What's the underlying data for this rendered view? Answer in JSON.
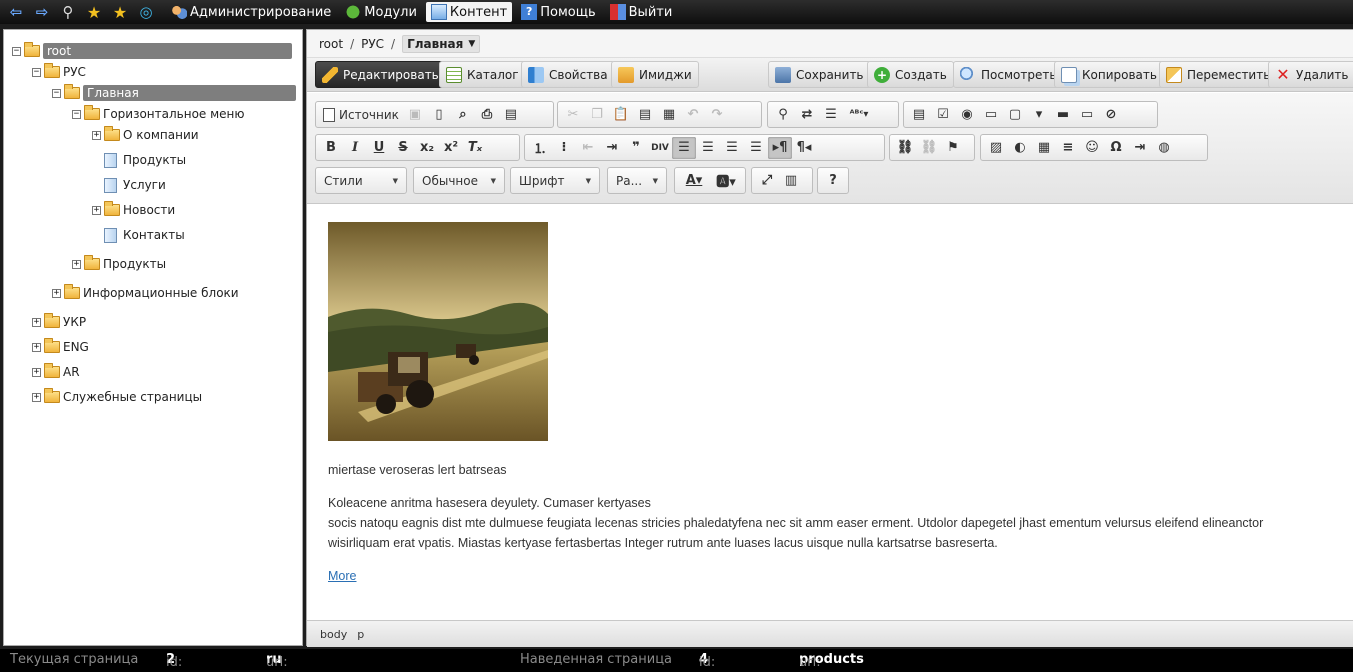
{
  "topbar": {
    "menu": [
      {
        "label": "Администрирование",
        "icon": "users-icon"
      },
      {
        "label": "Модули",
        "icon": "puzzle-icon"
      },
      {
        "label": "Контент",
        "icon": "content-icon",
        "active": true
      },
      {
        "label": "Помощь",
        "icon": "help-icon"
      },
      {
        "label": "Выйти",
        "icon": "exit-icon"
      }
    ]
  },
  "tree": {
    "root": "root",
    "rus": "РУС",
    "main": "Главная",
    "hmenu": "Горизонтальное меню",
    "about": "О компании",
    "products_page": "Продукты",
    "services": "Услуги",
    "news": "Новости",
    "contacts": "Контакты",
    "products": "Продукты",
    "infoblocks": "Информационные блоки",
    "ukr": "УКР",
    "eng": "ENG",
    "ar": "AR",
    "service_pages": "Служебные страницы"
  },
  "breadcrumb": {
    "root": "root",
    "rus": "РУС",
    "current": "Главная"
  },
  "actions": {
    "edit": "Редактировать",
    "catalog": "Каталог",
    "properties": "Свойства",
    "images": "Имиджи",
    "save": "Сохранить",
    "create": "Создать",
    "view": "Посмотреть",
    "copy": "Копировать",
    "move": "Переместить",
    "delete": "Удалить"
  },
  "editor": {
    "source": "Источник",
    "styles": "Стили",
    "format": "Обычное",
    "font": "Шрифт",
    "size": "Ра...",
    "help": "?"
  },
  "content": {
    "caption": "miertase veroseras lert batrseas",
    "line1": "Koleacene anritma hasesera deyulety. Cumaser kertyases",
    "line2": "socis natoqu eagnis dist mte dulmuese feugiata lecenas stricies phaledatyfena nec sit amm easer erment. Utdolor dapegetel jhast ementum velursus eleifend elineanctor",
    "line3": "wisirliquam erat vpatis. Miastas kertyase fertasbertas Integer rutrum ante luases lacus uisque nulla kartsatrse basreserta.",
    "more": "More"
  },
  "pathbar": {
    "body": "body",
    "p": "p"
  },
  "status": {
    "current_label": "Текущая страница",
    "id_label": "id:",
    "current_id": "2",
    "url_label": "url:",
    "current_url": "ru",
    "hover_label": "Наведенная страница",
    "hover_id": "4",
    "hover_url": "products"
  },
  "colors": {
    "accent": "#4a4a4a",
    "link": "#2a6fb4",
    "selection": "#7e7e7e"
  }
}
